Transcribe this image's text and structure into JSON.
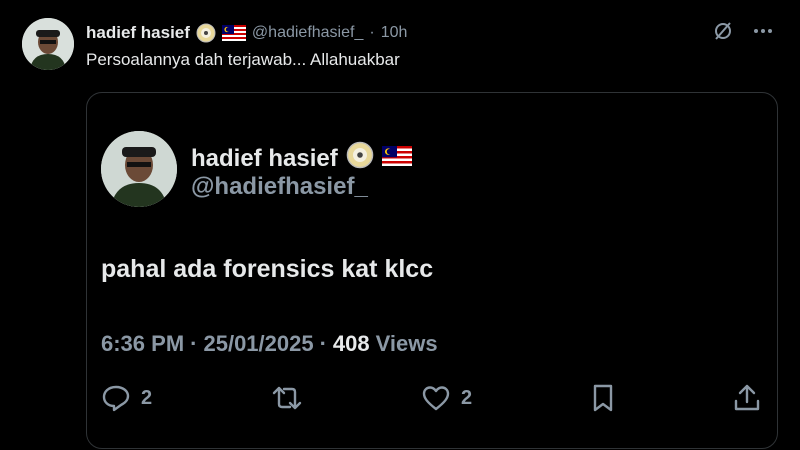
{
  "post": {
    "author": {
      "name": "hadief hasief",
      "handle": "@hadiefhasief_",
      "badges": [
        "cd-disc-icon",
        "malaysia-flag-icon"
      ]
    },
    "separator": "·",
    "time_ago": "10h",
    "text": "Persoalannya dah terjawab... Allahuakbar"
  },
  "quoted": {
    "author": {
      "name": "hadief hasief",
      "handle": "@hadiefhasief_"
    },
    "text": "pahal ada forensics kat klcc",
    "time": "6:36 PM",
    "date": "25/01/2025",
    "separator": "·",
    "views_count": "408",
    "views_label": "Views",
    "actions": {
      "reply_count": "2",
      "like_count": "2"
    }
  },
  "colors": {
    "background": "#000000",
    "text_primary": "#e7e9ea",
    "text_secondary": "#8b98a5",
    "border": "#2f3336"
  }
}
